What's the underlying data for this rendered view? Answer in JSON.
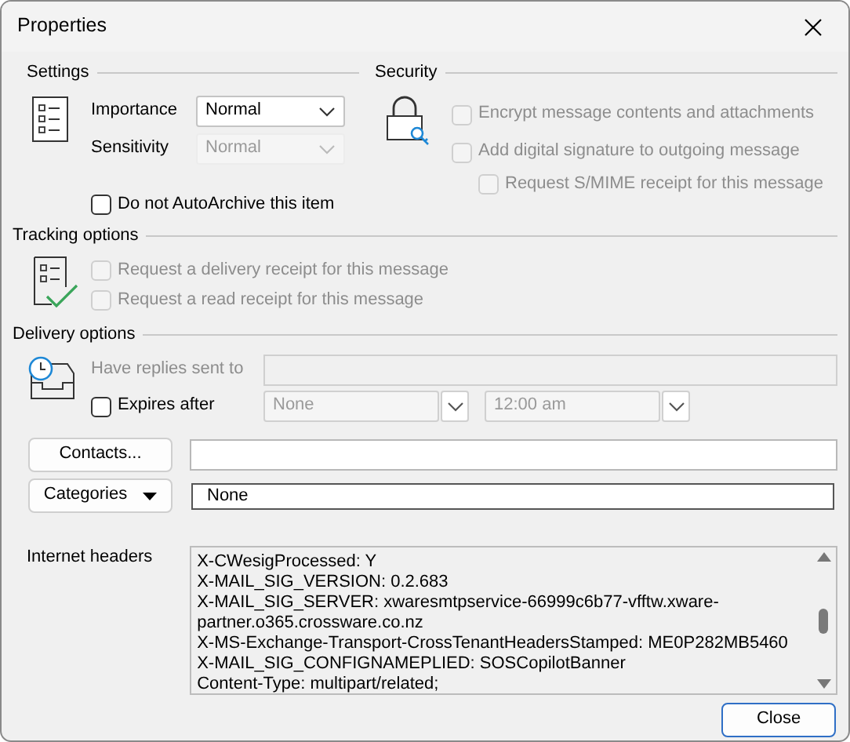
{
  "window": {
    "title": "Properties"
  },
  "settings": {
    "heading": "Settings",
    "fields": [
      {
        "label": "Importance",
        "value": "Normal",
        "disabled": false
      },
      {
        "label": "Sensitivity",
        "value": "Normal",
        "disabled": true
      }
    ],
    "autoarchive": {
      "label": "Do not AutoArchive this item",
      "checked": false,
      "disabled": false
    }
  },
  "security": {
    "heading": "Security",
    "options": [
      {
        "label": "Encrypt message contents and attachments",
        "checked": false,
        "disabled": true
      },
      {
        "label": "Add digital signature to outgoing message",
        "checked": false,
        "disabled": true,
        "children": [
          {
            "label": "Request S/MIME receipt for this message",
            "checked": false,
            "disabled": true
          }
        ]
      }
    ]
  },
  "tracking": {
    "heading": "Tracking options",
    "options": [
      {
        "label": "Request a delivery receipt for this message",
        "checked": false,
        "disabled": true
      },
      {
        "label": "Request a read receipt for this message",
        "checked": false,
        "disabled": true
      }
    ]
  },
  "delivery": {
    "heading": "Delivery options",
    "reply_to": {
      "label": "Have replies sent to",
      "disabled": true
    },
    "expires": {
      "label": "Expires after",
      "checked": false,
      "disabled": false,
      "date": "None",
      "time": "12:00 am",
      "fields_disabled": true
    }
  },
  "contacts": {
    "button": "Contacts..."
  },
  "categories": {
    "button": "Categories",
    "value": "None"
  },
  "internet_headers": {
    "label": "Internet headers",
    "lines": [
      "X-CWesigProcessed: Y",
      "X-MAIL_SIG_VERSION: 0.2.683",
      "X-MAIL_SIG_SERVER: xwaresmtpservice-66999c6b77-vfftw.xware-partner.o365.crossware.co.nz",
      "X-MS-Exchange-Transport-CrossTenantHeadersStamped: ME0P282MB5460",
      "X-MAIL_SIG_CONFIGNAMEPLIED: SOSCopilotBanner",
      "Content-Type: multipart/related;"
    ]
  },
  "footer": {
    "button": "Close"
  }
}
